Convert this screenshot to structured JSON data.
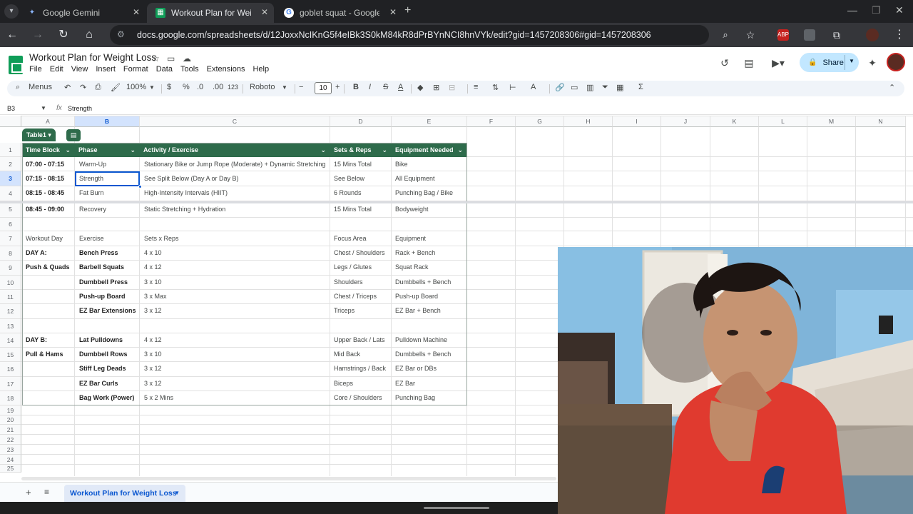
{
  "browser": {
    "tabs": [
      {
        "title": "Google Gemini",
        "favicon": "gemini-sparkle-icon",
        "active": false
      },
      {
        "title": "Workout Plan for Weight Lo",
        "favicon": "sheets-icon",
        "active": true
      },
      {
        "title": "goblet squat - Google Searc",
        "favicon": "google-g-icon",
        "active": false
      }
    ],
    "url": "docs.google.com/spreadsheets/d/12JoxxNcIKnG5f4eIBk3S0kM84kR8dPrBYnNCI8hnVYk/edit?gid=1457208306#gid=1457208306",
    "extensions": [
      "ABP"
    ]
  },
  "sheets": {
    "doc_title": "Workout Plan for Weight Loss",
    "menu": [
      "File",
      "Edit",
      "View",
      "Insert",
      "Format",
      "Data",
      "Tools",
      "Extensions",
      "Help"
    ],
    "share_label": "Share",
    "toolbar": {
      "search_label": "Menus",
      "zoom": "100%",
      "currency": "$",
      "percent": "%",
      "dec_decrease": ".0",
      "dec_increase": ".00",
      "number_format": "123",
      "font": "Roboto",
      "font_size": "10"
    },
    "formula_bar": {
      "cell_ref": "B3",
      "value": "Strength"
    },
    "columns": [
      "A",
      "B",
      "C",
      "D",
      "E",
      "F",
      "G",
      "H",
      "I",
      "J",
      "K",
      "L",
      "M",
      "N"
    ],
    "rows": [
      "1",
      "2",
      "3",
      "4",
      "5",
      "6",
      "7",
      "8",
      "9",
      "10",
      "11",
      "12",
      "13",
      "14",
      "15",
      "16",
      "17",
      "18",
      "19",
      "20",
      "21",
      "22",
      "23",
      "24",
      "25"
    ],
    "table_name": "Table1",
    "headers": [
      "Time Block",
      "Phase",
      "Activity / Exercise",
      "Sets & Reps",
      "Equipment Needed"
    ],
    "schedule": [
      {
        "time": "07:00 - 07:15",
        "phase": "Warm-Up",
        "activity": "Stationary Bike or Jump Rope (Moderate) + Dynamic Stretching",
        "sets": "15 Mins Total",
        "equipment": "Bike"
      },
      {
        "time": "07:15 - 08:15",
        "phase": "Strength",
        "activity": "See Split Below (Day A or Day B)",
        "sets": "See Below",
        "equipment": "All Equipment"
      },
      {
        "time": "08:15 - 08:45",
        "phase": "Fat Burn",
        "activity": "High-Intensity Intervals (HIIT)",
        "sets": "6 Rounds",
        "equipment": "Punching Bag / Bike"
      },
      {
        "time": "08:45 - 09:00",
        "phase": "Recovery",
        "activity": "Static Stretching + Hydration",
        "sets": "15 Mins Total",
        "equipment": "Bodyweight"
      }
    ],
    "split_headers": [
      "Workout Day",
      "Exercise",
      "Sets x Reps",
      "Focus Area",
      "Equipment"
    ],
    "day_a": [
      {
        "day": "DAY A:",
        "exercise": "Bench Press",
        "sets": "4 x 10",
        "focus": "Chest / Shoulders",
        "equipment": "Rack + Bench"
      },
      {
        "day": "Push & Quads",
        "exercise": "Barbell Squats",
        "sets": "4 x 12",
        "focus": "Legs / Glutes",
        "equipment": "Squat Rack"
      },
      {
        "day": "",
        "exercise": "Dumbbell Press",
        "sets": "3 x 10",
        "focus": "Shoulders",
        "equipment": "Dumbbells + Bench"
      },
      {
        "day": "",
        "exercise": "Push-up Board",
        "sets": "3 x Max",
        "focus": "Chest / Triceps",
        "equipment": "Push-up Board"
      },
      {
        "day": "",
        "exercise": "EZ Bar Extensions",
        "sets": "3 x 12",
        "focus": "Triceps",
        "equipment": "EZ Bar + Bench"
      }
    ],
    "day_b": [
      {
        "day": "DAY B:",
        "exercise": "Lat Pulldowns",
        "sets": "4 x 12",
        "focus": "Upper Back / Lats",
        "equipment": "Pulldown Machine"
      },
      {
        "day": "Pull & Hams",
        "exercise": "Dumbbell Rows",
        "sets": "3 x 10",
        "focus": "Mid Back",
        "equipment": "Dumbbells + Bench"
      },
      {
        "day": "",
        "exercise": "Stiff Leg Deads",
        "sets": "3 x 12",
        "focus": "Hamstrings / Back",
        "equipment": "EZ Bar or DBs"
      },
      {
        "day": "",
        "exercise": "EZ Bar Curls",
        "sets": "3 x 12",
        "focus": "Biceps",
        "equipment": "EZ Bar"
      },
      {
        "day": "",
        "exercise": "Bag Work (Power)",
        "sets": "5 x 2 Mins",
        "focus": "Core / Shoulders",
        "equipment": "Punching Bag"
      }
    ],
    "sheet_tab": "Workout Plan for Weight Loss"
  },
  "colors": {
    "table_header": "#2e6b4b",
    "selection": "#0b57d0",
    "share_bg": "#c2e7ff",
    "browser_dark": "#202124"
  }
}
